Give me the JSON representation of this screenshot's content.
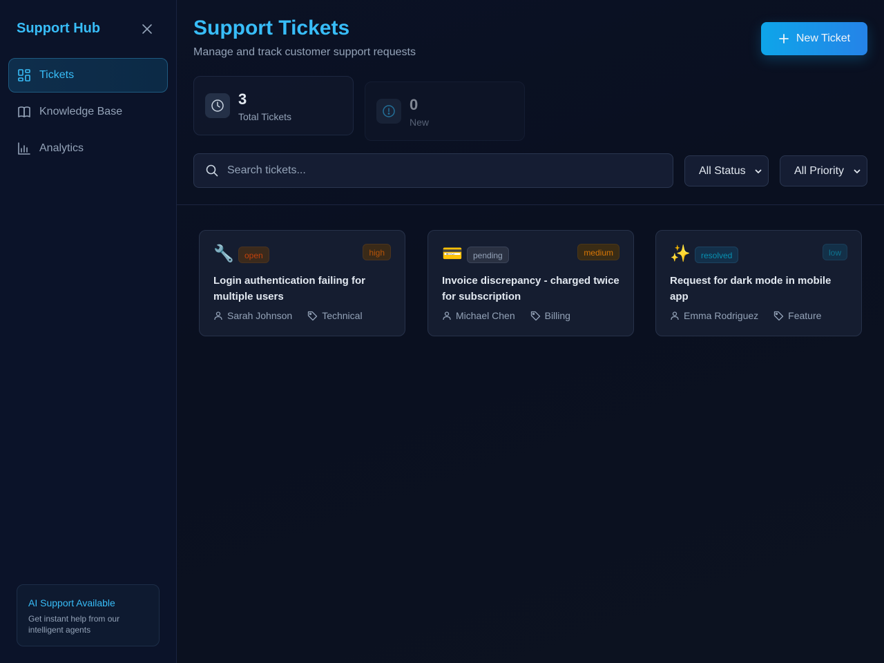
{
  "sidebar": {
    "brand": "Support Hub",
    "items": [
      {
        "label": "Tickets",
        "icon": "grid-icon",
        "active": true
      },
      {
        "label": "Knowledge Base",
        "icon": "book-icon",
        "active": false
      },
      {
        "label": "Analytics",
        "icon": "bar-chart-icon",
        "active": false
      }
    ],
    "ai_card": {
      "title": "AI Support Available",
      "description": "Get instant help from our intelligent agents"
    }
  },
  "header": {
    "title": "Support Tickets",
    "subtitle": "Manage and track customer support requests",
    "new_button_label": "New Ticket"
  },
  "stats": [
    {
      "value": "3",
      "label": "Total Tickets",
      "icon": "clock-icon"
    },
    {
      "value": "0",
      "label": "New",
      "icon": "alert-circle-icon"
    }
  ],
  "filters": {
    "search_placeholder": "Search tickets...",
    "status_selected": "All Status",
    "priority_selected": "All Priority"
  },
  "tickets": [
    {
      "emoji": "🔧",
      "status": "open",
      "priority": "high",
      "title": "Login authentication failing for multiple users",
      "customer": "Sarah Johnson",
      "category": "Technical"
    },
    {
      "emoji": "💳",
      "status": "pending",
      "priority": "medium",
      "title": "Invoice discrepancy - charged twice for subscription",
      "customer": "Michael Chen",
      "category": "Billing"
    },
    {
      "emoji": "✨",
      "status": "resolved",
      "priority": "low",
      "title": "Request for dark mode in mobile app",
      "customer": "Emma Rodriguez",
      "category": "Feature"
    }
  ],
  "colors": {
    "accent": "#38bdf8",
    "button_gradient_start": "#0ea5e9",
    "button_gradient_end": "#2583e8",
    "status_open": "#c2410c",
    "status_pending": "#94a3b8",
    "status_resolved": "#0891b2",
    "priority_high": "#b45309",
    "priority_medium": "#d97706",
    "priority_low": "#0e7490"
  }
}
